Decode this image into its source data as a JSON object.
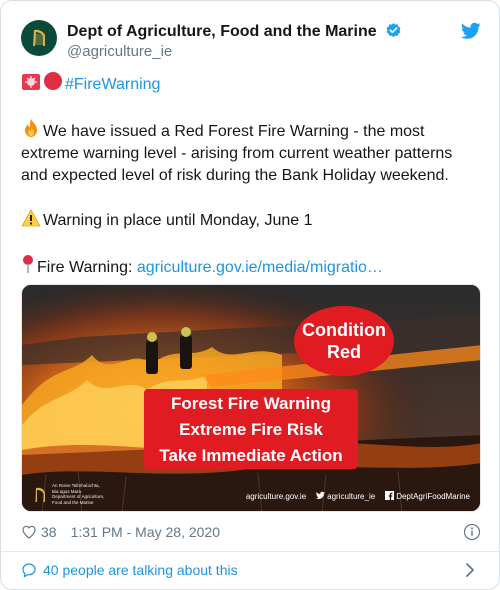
{
  "account": {
    "display_name": "Dept of Agriculture, Food and the Marine",
    "handle": "@agriculture_ie",
    "avatar_icon": "harp-icon",
    "verified_icon": "verified-badge-icon",
    "platform_icon": "twitter-bird-icon"
  },
  "tweet": {
    "hashtag": "#FireWarning",
    "paragraph1": "We have issued a Red Forest Fire Warning - the most extreme warning level - arising from current weather  patterns and expected level of risk during the Bank Holiday weekend.",
    "paragraph2": "Warning in place until Monday, June 1",
    "paragraph3_label": "Fire Warning: ",
    "paragraph3_link": "agriculture.gov.ie/media/migratio…"
  },
  "media": {
    "condition_line1": "Condition",
    "condition_line2": "Red",
    "warning_line1": "Forest Fire Warning",
    "warning_line2": "Extreme Fire Risk",
    "warning_line3": "Take Immediate Action",
    "dept_line1": "An Roinn Talmhaíochta,",
    "dept_line2": "Bia agus Mara",
    "dept_line3": "Department of Agriculture,",
    "dept_line4": "Food and the Marine",
    "footer_site": "agriculture.gov.ie",
    "footer_twitter": "agriculture_ie",
    "footer_facebook": "DeptAgriFoodMarine"
  },
  "meta": {
    "likes": "38",
    "timestamp": "1:31 PM - May 28, 2020"
  },
  "talking": {
    "label": "40 people are talking about this"
  },
  "colors": {
    "link": "#1b95e0",
    "warning_red": "#e11b22",
    "muted": "#657786"
  }
}
